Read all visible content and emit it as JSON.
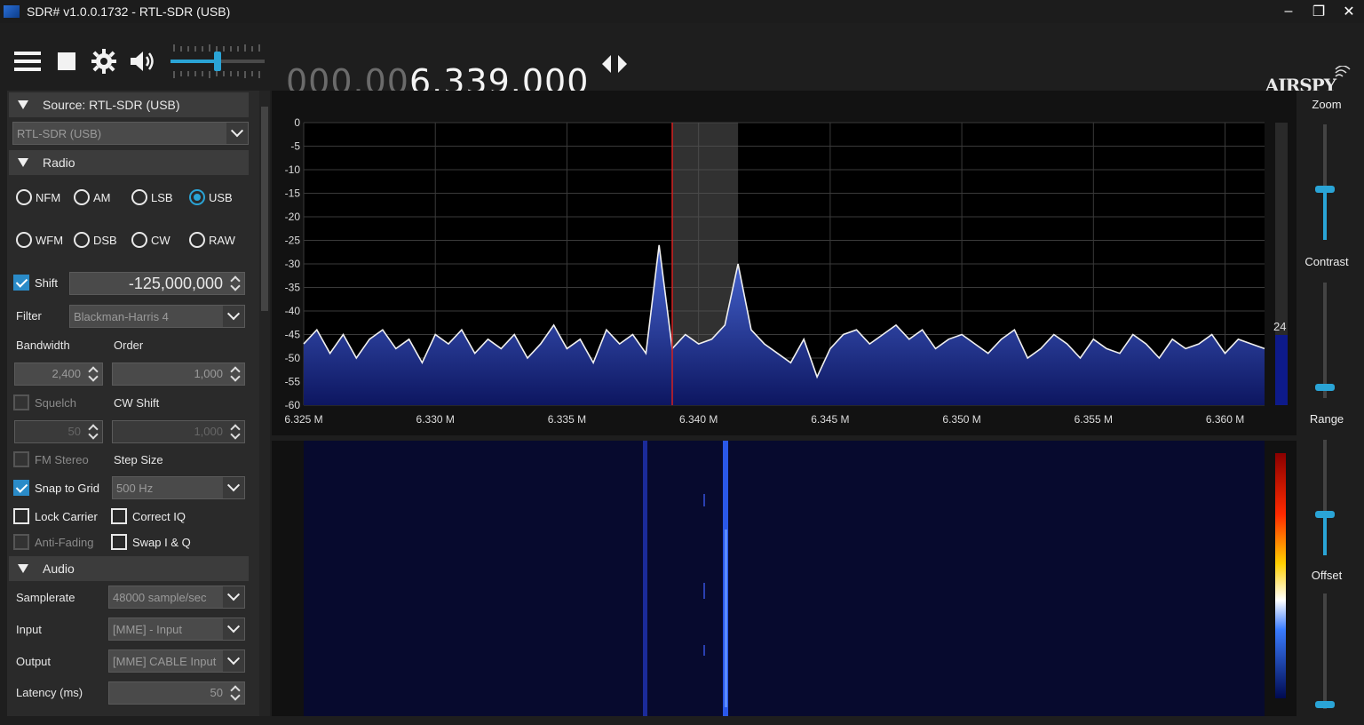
{
  "window": {
    "title": "SDR# v1.0.0.1732 - RTL-SDR (USB)",
    "minimize": "–",
    "restore": "❐",
    "close": "✕"
  },
  "toolbar": {
    "freq_dim": "000.00",
    "freq_bright": "6.339.000",
    "brand": "AIRSPY",
    "volume_level": 0.5
  },
  "source": {
    "header": "Source: RTL-SDR (USB)",
    "device": "RTL-SDR (USB)"
  },
  "radio": {
    "header": "Radio",
    "modes_row1": [
      "NFM",
      "AM",
      "LSB",
      "USB"
    ],
    "modes_row2": [
      "WFM",
      "DSB",
      "CW",
      "RAW"
    ],
    "selected_mode": "USB",
    "shift_label": "Shift",
    "shift_value": "-125,000,000",
    "filter_label": "Filter",
    "filter_value": "Blackman-Harris 4",
    "bandwidth_label": "Bandwidth",
    "order_label": "Order",
    "bandwidth_value": "2,400",
    "order_value": "1,000",
    "squelch_label": "Squelch",
    "cw_shift_label": "CW Shift",
    "squelch_value": "50",
    "cw_shift_value": "1,000",
    "fm_stereo_label": "FM Stereo",
    "step_size_label": "Step Size",
    "snap_label": "Snap to Grid",
    "step_value": "500 Hz",
    "lock_carrier_label": "Lock Carrier",
    "correct_iq_label": "Correct IQ",
    "anti_fading_label": "Anti-Fading",
    "swap_iq_label": "Swap I & Q"
  },
  "audio": {
    "header": "Audio",
    "samplerate_label": "Samplerate",
    "samplerate_value": "48000 sample/sec",
    "input_label": "Input",
    "input_value": "[MME] - Input",
    "output_label": "Output",
    "output_value": "[MME] CABLE Input",
    "latency_label": "Latency (ms)",
    "latency_value": "50"
  },
  "right_panel": {
    "zoom": "Zoom",
    "contrast": "Contrast",
    "range": "Range",
    "offset": "Offset",
    "level_readout": "24"
  },
  "chart_data": {
    "type": "line",
    "title": "",
    "xlabel": "",
    "ylabel": "",
    "x_ticks": [
      "6.325 M",
      "6.330 M",
      "6.335 M",
      "6.340 M",
      "6.345 M",
      "6.350 M",
      "6.355 M",
      "6.360 M"
    ],
    "y_ticks": [
      "0",
      "-5",
      "-10",
      "-15",
      "-20",
      "-25",
      "-30",
      "-35",
      "-40",
      "-45",
      "-50",
      "-55",
      "-60"
    ],
    "xlim": [
      6.325,
      6.3615
    ],
    "ylim": [
      -60,
      0
    ],
    "tuned_frequency_mhz": 6.339,
    "passband_mhz": [
      6.339,
      6.3415
    ],
    "series": [
      {
        "x": [
          6.325,
          6.3255,
          6.326,
          6.3265,
          6.327,
          6.3275,
          6.328,
          6.3285,
          6.329,
          6.3295,
          6.33,
          6.3305,
          6.331,
          6.3315,
          6.332,
          6.3325,
          6.333,
          6.3335,
          6.334,
          6.3345,
          6.335,
          6.3355,
          6.336,
          6.3365,
          6.337,
          6.3375,
          6.338,
          6.3385,
          6.339,
          6.3395,
          6.34,
          6.3405,
          6.341,
          6.3415,
          6.342,
          6.3425,
          6.343,
          6.3435,
          6.344,
          6.3445,
          6.345,
          6.3455,
          6.346,
          6.3465,
          6.347,
          6.3475,
          6.348,
          6.3485,
          6.349,
          6.3495,
          6.35,
          6.3505,
          6.351,
          6.3515,
          6.352,
          6.3525,
          6.353,
          6.3535,
          6.354,
          6.3545,
          6.355,
          6.3555,
          6.356,
          6.3565,
          6.357,
          6.3575,
          6.358,
          6.3585,
          6.359,
          6.3595,
          6.36,
          6.3605,
          6.361,
          6.3615
        ],
        "y": [
          -47,
          -44,
          -49,
          -45,
          -50,
          -46,
          -44,
          -48,
          -46,
          -51,
          -45,
          -47,
          -44,
          -49,
          -46,
          -48,
          -45,
          -50,
          -47,
          -43,
          -48,
          -46,
          -51,
          -44,
          -47,
          -45,
          -49,
          -26,
          -48,
          -45,
          -47,
          -46,
          -43,
          -30,
          -44,
          -47,
          -49,
          -51,
          -46,
          -54,
          -48,
          -45,
          -44,
          -47,
          -45,
          -43,
          -46,
          -44,
          -48,
          -46,
          -45,
          -47,
          -49,
          -46,
          -44,
          -50,
          -48,
          -45,
          -47,
          -50,
          -46,
          -48,
          -49,
          -45,
          -47,
          -50,
          -46,
          -48,
          -47,
          -45,
          -49,
          -46,
          -47,
          -48
        ]
      }
    ]
  }
}
